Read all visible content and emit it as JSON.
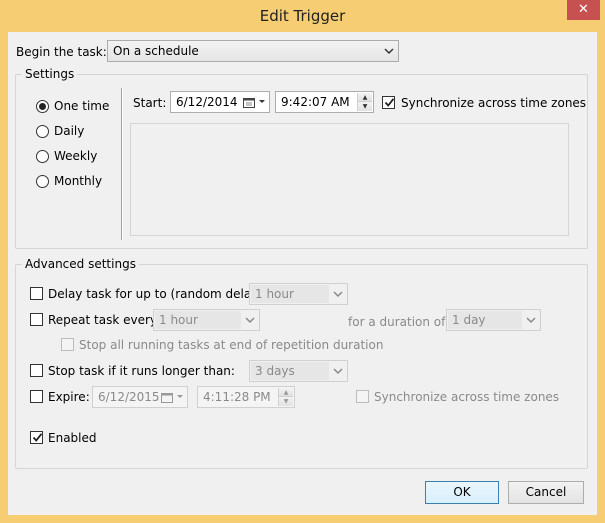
{
  "window": {
    "title": "Edit Trigger",
    "close_glyph": "✕"
  },
  "begin": {
    "label": "Begin the task:",
    "value": "On a schedule"
  },
  "settings": {
    "legend": "Settings",
    "radios": [
      {
        "label": "One time",
        "checked": true
      },
      {
        "label": "Daily",
        "checked": false
      },
      {
        "label": "Weekly",
        "checked": false
      },
      {
        "label": "Monthly",
        "checked": false
      }
    ],
    "start_label": "Start:",
    "start_date": "6/12/2014",
    "start_time": "9:42:07 AM",
    "sync_label": "Synchronize across time zones",
    "sync_checked": true
  },
  "advanced": {
    "legend": "Advanced settings",
    "delay_label": "Delay task for up to (random delay):",
    "delay_value": "1 hour",
    "repeat_label": "Repeat task every:",
    "repeat_value": "1 hour",
    "duration_label": "for a duration of:",
    "duration_value": "1 day",
    "stop_running_label": "Stop all running tasks at end of repetition duration",
    "stop_longer_label": "Stop task if it runs longer than:",
    "stop_longer_value": "3 days",
    "expire_label": "Expire:",
    "expire_date": "6/12/2015",
    "expire_time": "4:11:28 PM",
    "expire_sync_label": "Synchronize across time zones",
    "enabled_label": "Enabled",
    "enabled_checked": true
  },
  "buttons": {
    "ok": "OK",
    "cancel": "Cancel"
  },
  "colors": {
    "frame": "#f6cd72",
    "close": "#c75050",
    "client": "#f0f0f0"
  }
}
